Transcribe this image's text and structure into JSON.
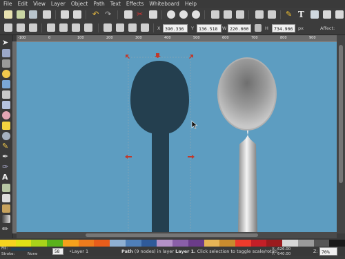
{
  "menu": [
    "File",
    "Edit",
    "View",
    "Layer",
    "Object",
    "Path",
    "Text",
    "Effects",
    "Whiteboard",
    "Help"
  ],
  "controls": {
    "x_label": "X",
    "x_value": "390.336",
    "y_label": "Y",
    "y_value": "136.518",
    "w_label": "W",
    "w_value": "220.000",
    "h_label": "H",
    "h_value": "734.906",
    "unit": "px",
    "affect_label": "Affect:"
  },
  "ruler_marks": [
    "-100",
    "0",
    "100",
    "200",
    "300",
    "400",
    "500",
    "600",
    "700",
    "800",
    "900"
  ],
  "canvas": {
    "background": "#5d9dc1",
    "dark_spoon_color": "#243f4f",
    "selection_color": "#c0392b"
  },
  "palette": [
    "#f6d31f",
    "#dfe116",
    "#a9d31a",
    "#5ab21b",
    "#f5a11c",
    "#ee7b1d",
    "#e85d1b",
    "#8fb0d2",
    "#4f7fb8",
    "#2f5a9a",
    "#b491c8",
    "#8a5fa8",
    "#6b3c8a",
    "#e6b556",
    "#c98c2e",
    "#ef3b2c",
    "#c51f27",
    "#9b1b1e",
    "#d7d7d7",
    "#9b9b9b",
    "#555555",
    "#1a1a1a"
  ],
  "status": {
    "fill_label": "Fill:",
    "stroke_label": "Stroke:",
    "stroke_width": "None",
    "opacity": "58",
    "layer": "•Layer 1",
    "message_prefix": "Path",
    "message": "(9 nodes) in layer",
    "message_layer": "Layer 1.",
    "message_suffix": "Click selection to toggle scale/rotati",
    "x_label": "X:",
    "x_value": "626.00",
    "y_label": "Y:",
    "y_value": "640.00",
    "zoom_label": "Z:",
    "zoom": "70%"
  }
}
